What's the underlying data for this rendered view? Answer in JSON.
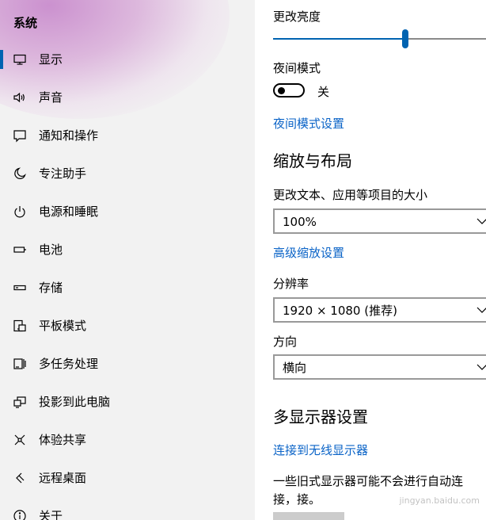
{
  "sidebar": {
    "title": "系统",
    "selected_index": 0,
    "items": [
      {
        "label": "显示",
        "icon": "monitor-icon"
      },
      {
        "label": "声音",
        "icon": "speaker-icon"
      },
      {
        "label": "通知和操作",
        "icon": "message-icon"
      },
      {
        "label": "专注助手",
        "icon": "moon-icon"
      },
      {
        "label": "电源和睡眠",
        "icon": "power-icon"
      },
      {
        "label": "电池",
        "icon": "battery-icon"
      },
      {
        "label": "存储",
        "icon": "drive-icon"
      },
      {
        "label": "平板模式",
        "icon": "tablet-mode-icon"
      },
      {
        "label": "多任务处理",
        "icon": "multitask-icon"
      },
      {
        "label": "投影到此电脑",
        "icon": "project-icon"
      },
      {
        "label": "体验共享",
        "icon": "share-icon"
      },
      {
        "label": "远程桌面",
        "icon": "remote-desktop-icon"
      },
      {
        "label": "关于",
        "icon": "info-icon"
      }
    ]
  },
  "brightness": {
    "label": "更改亮度",
    "value": 0.62
  },
  "night_mode": {
    "label": "夜间模式",
    "state_label": "关",
    "is_on": false,
    "settings_link": "夜间模式设置"
  },
  "scale_layout": {
    "heading": "缩放与布局",
    "scale_label": "更改文本、应用等项目的大小",
    "scale_value": "100%",
    "advanced_link": "高级缩放设置",
    "resolution_label": "分辨率",
    "resolution_value": "1920 × 1080 (推荐)",
    "orientation_label": "方向",
    "orientation_value": "横向"
  },
  "multi_display": {
    "heading": "多显示器设置",
    "wireless_link": "连接到无线显示器",
    "description": "一些旧式显示器可能不会进行自动连接，接。"
  },
  "watermark": "jingyan.baidu.com",
  "colors": {
    "accent": "#0063b1",
    "link": "#0a63c7"
  }
}
